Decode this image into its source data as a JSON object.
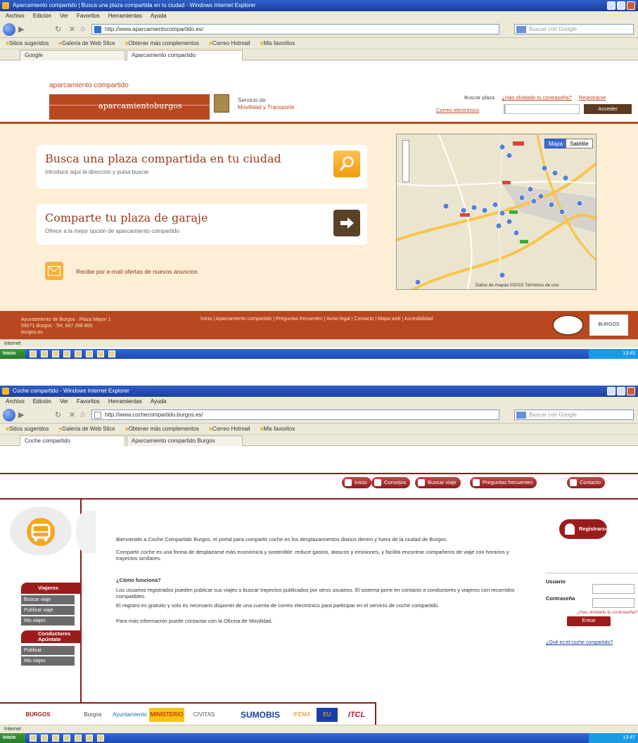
{
  "shot1": {
    "window_title": "Aparcamiento compartido | Busca una plaza compartida en tu ciudad - Windows Internet Explorer",
    "menu": [
      "Archivo",
      "Edición",
      "Ver",
      "Favoritos",
      "Herramientas",
      "Ayuda"
    ],
    "url": "http://www.aparcamientocompartido.es/",
    "search_placeholder": "Buscar con Google",
    "favorites": [
      "Sitios sugeridos",
      "Galería de Web Slice",
      "Obtener más complementos",
      "Correo Hotmail",
      "Mis favoritos"
    ],
    "tabs": [
      "Google",
      "Aparcamiento compartido"
    ],
    "site": {
      "site_name": "aparcamiento compartido",
      "banner_text": "aparcamientoburgos",
      "dept_line1": "Servicio de",
      "dept_line2": "Movilidad y Transporte",
      "toplinks": [
        "Buscar plaza",
        "¿Has olvidado tu contraseña?",
        "Registrarse"
      ],
      "login_label": "Correo electrónico",
      "login_button": "Acceder"
    },
    "cards": [
      {
        "title": "Busca una plaza compartida en tu ciudad",
        "subtitle": "Introduce aquí la dirección y pulsa buscar"
      },
      {
        "title": "Comparte tu plaza de garaje",
        "subtitle": "Ofrece a la mejor opción de aparcamiento compartido"
      }
    ],
    "newsletter": "Recibe por e-mail ofertas de nuevos anuncios",
    "map": {
      "btn_map": "Mapa",
      "btn_sat": "Satélite",
      "footer": "Datos de mapas ©2010  Términos de uso"
    },
    "footer": {
      "address": [
        "Ayuntamiento de Burgos · Plaza Mayor 1",
        "09071 Burgos · Tel. 947 288 800",
        "burgos.es"
      ],
      "links": "Inicio | Aparcamiento compartido | Preguntas frecuentes | Aviso legal | Contacto | Mapa web | Accesibilidad",
      "logo2": "BURGOS"
    },
    "status": "Internet",
    "taskbar": {
      "start": "Inicio",
      "clock": "13:45"
    }
  },
  "shot2": {
    "window_title": "Coche compartido - Windows Internet Explorer",
    "menu": [
      "Archivo",
      "Edición",
      "Ver",
      "Favoritos",
      "Herramientas",
      "Ayuda"
    ],
    "url": "http://www.cochecompartido.burgos.es/",
    "search_placeholder": "Buscar con Google",
    "favorites": [
      "Sitios sugeridos",
      "Galería de Web Slice",
      "Obtener más complementos",
      "Correo Hotmail",
      "Mis favoritos"
    ],
    "tabs": [
      "Coche compartido",
      "Aparcamiento compartido Burgos"
    ],
    "nav": [
      "Inicio",
      "Consejos",
      "Buscar viaje",
      "Preguntas frecuentes",
      "Contacto"
    ],
    "sidebar": {
      "head1": "Viajeros",
      "items1": [
        "Buscar viaje",
        "Publicar viaje",
        "Mis viajes"
      ],
      "head2_line1": "Conductores",
      "head2_line2": "Apúntate",
      "items2": [
        "Publicar",
        "Mis viajes"
      ]
    },
    "content": {
      "p1": "Bienvenido a Coche Compartido Burgos, el portal para compartir coche en los desplazamientos diarios dentro y fuera de la ciudad de Burgos.",
      "p2": "Compartir coche es una forma de desplazarse más económica y sostenible: reduce gastos, atascos y emisiones, y facilita encontrar compañeros de viaje con horarios y trayectos similares.",
      "h": "¿Cómo funciona?",
      "p3": "Los usuarios registrados pueden publicar sus viajes o buscar trayectos publicados por otros usuarios. El sistema pone en contacto a conductores y viajeros con recorridos compatibles.",
      "p4": "El registro es gratuito y solo es necesario disponer de una cuenta de correo electrónico para participar en el servicio de coche compartido.",
      "p5": "Para más información puede contactar con la Oficina de Movilidad."
    },
    "register_button": "Registrarse",
    "login": {
      "user_label": "Usuario",
      "pass_label": "Contraseña",
      "forgot": "¿Has olvidado tu contraseña?",
      "button": "Entrar"
    },
    "bottom_link": "¿Qué es el coche compartido?",
    "logos": [
      "BURGOS",
      "Burgos",
      "Ayuntamiento",
      "MINISTERIO",
      "CIVITAS",
      "SUMOBIS",
      "IFEMA",
      "EU",
      "ITCL"
    ],
    "status": "Internet",
    "taskbar": {
      "start": "Inicio",
      "clock": "13:47"
    }
  }
}
